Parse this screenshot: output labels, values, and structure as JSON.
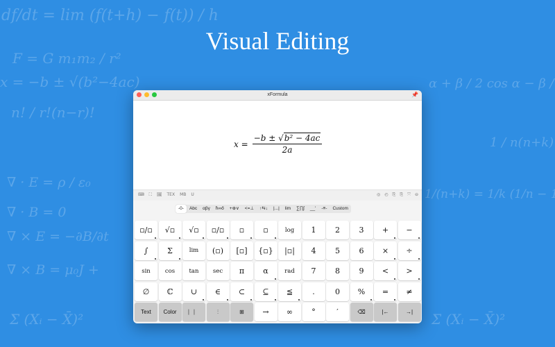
{
  "headline": "Visual Editing",
  "background_formulas": [
    "df/dt = lim (f(t+h) − f(t)) / h",
    "F = G m₁m₂ / r²",
    "x = −b ± √(b²−4ac)",
    "n! / r!(n−r)!",
    "∇ · E = ρ / ε₀",
    "∇ · B = 0",
    "∇ × E = −∂B/∂t",
    "∇ × B = μ₀J +",
    "Σ (Xᵢ − X̄)²",
    "α + β / 2 cos α − β / 2",
    "1 / n(n+k)",
    "1/(n+k) = 1/k (1/n − 1/(n+k))",
    "Σ (Xᵢ − X̄)²"
  ],
  "window": {
    "title": "xFormula",
    "formula": {
      "lhs": "x =",
      "numerator_prefix": "−b ± ",
      "sqrt_radicand": "b² − 4ac",
      "denominator": "2a"
    },
    "toolbar_left": [
      "⌨",
      "⛶",
      "🖼",
      "TEX",
      "MB",
      "U"
    ],
    "toolbar_right": [
      "◎",
      "◴",
      "⎘",
      "⎘",
      "⤧",
      "⊖"
    ],
    "category_tabs": [
      "-0-",
      "Abc",
      "αβγ",
      "ħ∞ő",
      "+⊕∨",
      "<=⊥",
      "↑⇆↓",
      "|...|",
      "lim",
      "∑∏∫",
      "__'",
      "-≡-",
      "Custom"
    ],
    "active_tab": "-0-",
    "keys": [
      [
        "▫/▫",
        "√▫",
        "√▫",
        "▫/▫",
        "▫",
        "▫",
        "log",
        "1",
        "2",
        "3",
        "+",
        "−"
      ],
      [
        "∫",
        "Σ",
        "lim",
        "(▫)",
        "[▫]",
        "{▫}",
        "|▫|",
        "4",
        "5",
        "6",
        "×",
        "÷"
      ],
      [
        "sin",
        "cos",
        "tan",
        "sec",
        "π",
        "α",
        "rad",
        "7",
        "8",
        "9",
        "<",
        ">"
      ],
      [
        "∅",
        "ℂ",
        "∪",
        "∈",
        "⊂",
        "⊆",
        "≦",
        ".",
        "0",
        "%",
        "=",
        "≠"
      ],
      [
        "Text",
        "Color",
        "⎸⎸",
        "⫶",
        "⊞",
        "→",
        "∞",
        "°",
        "′",
        "⌫",
        "|←",
        "→|"
      ]
    ]
  }
}
